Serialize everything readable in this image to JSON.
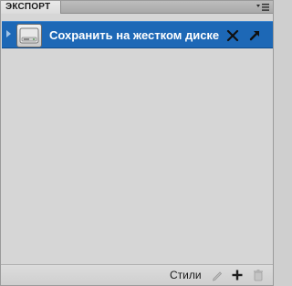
{
  "panel": {
    "tab_title": "ЭКСПОРТ",
    "menu_icon": "panel-menu-icon"
  },
  "preset_row": {
    "label": "Сохранить на жестком диске",
    "icon": "hard-drive-icon",
    "selected": true,
    "accent_color": "#1d68b6"
  },
  "toolbar": {
    "styles_label": "Стили",
    "icons": [
      "pencil-icon",
      "plus-icon",
      "trash-icon"
    ]
  }
}
